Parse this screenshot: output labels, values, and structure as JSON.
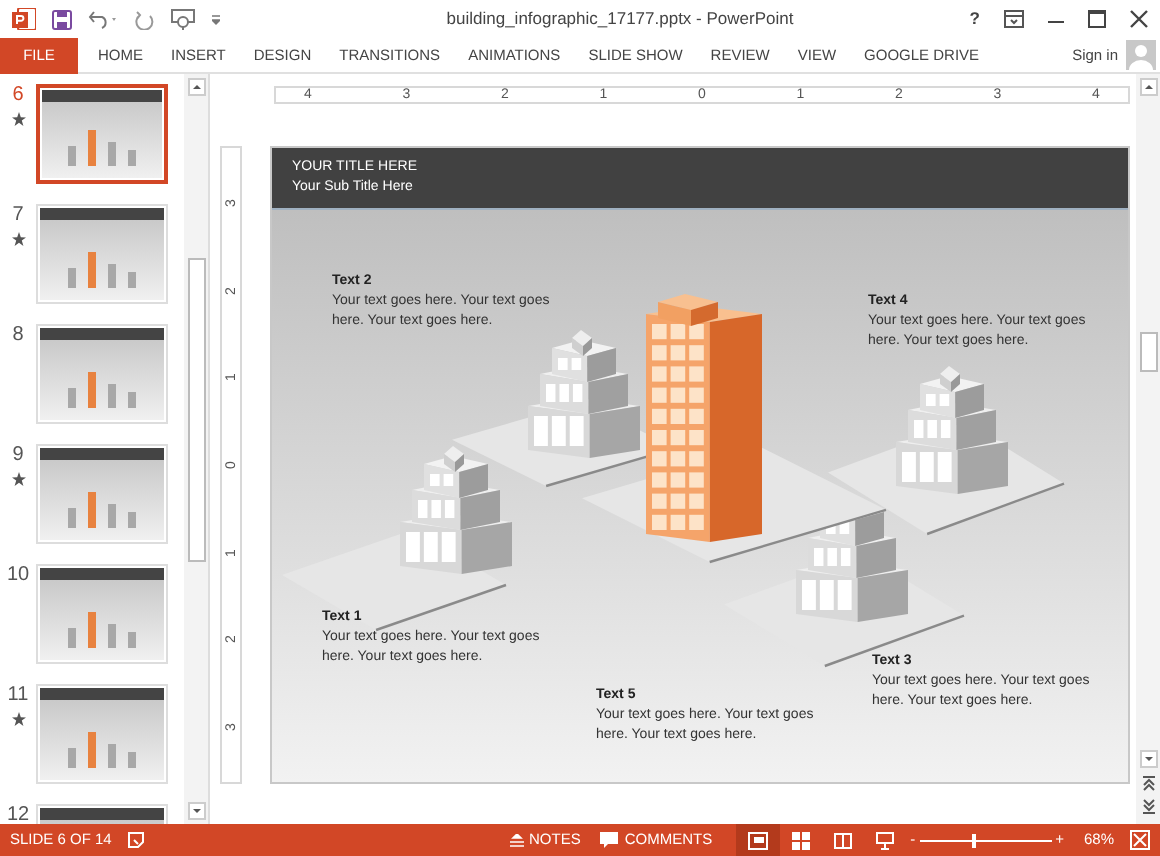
{
  "window": {
    "title": "building_infographic_17177.pptx - PowerPoint",
    "help": "?"
  },
  "ribbon": {
    "tabs": [
      {
        "label": "FILE",
        "kind": "file"
      },
      {
        "label": "HOME",
        "kind": "tab"
      },
      {
        "label": "INSERT",
        "kind": "tab"
      },
      {
        "label": "DESIGN",
        "kind": "tab"
      },
      {
        "label": "TRANSITIONS",
        "kind": "tab"
      },
      {
        "label": "ANIMATIONS",
        "kind": "tab"
      },
      {
        "label": "SLIDE SHOW",
        "kind": "tab"
      },
      {
        "label": "REVIEW",
        "kind": "tab"
      },
      {
        "label": "VIEW",
        "kind": "tab"
      },
      {
        "label": "GOOGLE DRIVE",
        "kind": "tab"
      }
    ],
    "sign_in": "Sign in"
  },
  "slides": [
    {
      "number": "6",
      "animated": true,
      "selected": true
    },
    {
      "number": "7",
      "animated": true,
      "selected": false
    },
    {
      "number": "8",
      "animated": false,
      "selected": false
    },
    {
      "number": "9",
      "animated": true,
      "selected": false
    },
    {
      "number": "10",
      "animated": false,
      "selected": false
    },
    {
      "number": "11",
      "animated": true,
      "selected": false
    },
    {
      "number": "12",
      "animated": false,
      "selected": false
    }
  ],
  "ruler": {
    "horizontal": [
      "4",
      "3",
      "2",
      "1",
      "0",
      "1",
      "2",
      "3",
      "4"
    ],
    "vertical": [
      "3",
      "2",
      "1",
      "0",
      "1",
      "2",
      "3"
    ]
  },
  "slide": {
    "title": "YOUR TITLE HERE",
    "subtitle": "Your Sub Title Here",
    "texts": [
      {
        "heading": "Text 2",
        "body": "Your text goes here. Your text goes here. Your text goes here."
      },
      {
        "heading": "Text 4",
        "body": "Your text goes here. Your text goes here. Your text goes here."
      },
      {
        "heading": "Text 1",
        "body": "Your text goes here. Your text goes here. Your text goes here."
      },
      {
        "heading": "Text 5",
        "body": "Your text goes here. Your text goes here. Your text goes here."
      },
      {
        "heading": "Text 3",
        "body": "Your text goes here. Your text goes here. Your text goes here."
      }
    ]
  },
  "status_bar": {
    "slide_info": "SLIDE 6 OF 14",
    "notes": "NOTES",
    "comments": "COMMENTS",
    "zoom_out": "-",
    "zoom_in": "+",
    "zoom": {
      "level": 0.42,
      "reading": "68%"
    }
  }
}
